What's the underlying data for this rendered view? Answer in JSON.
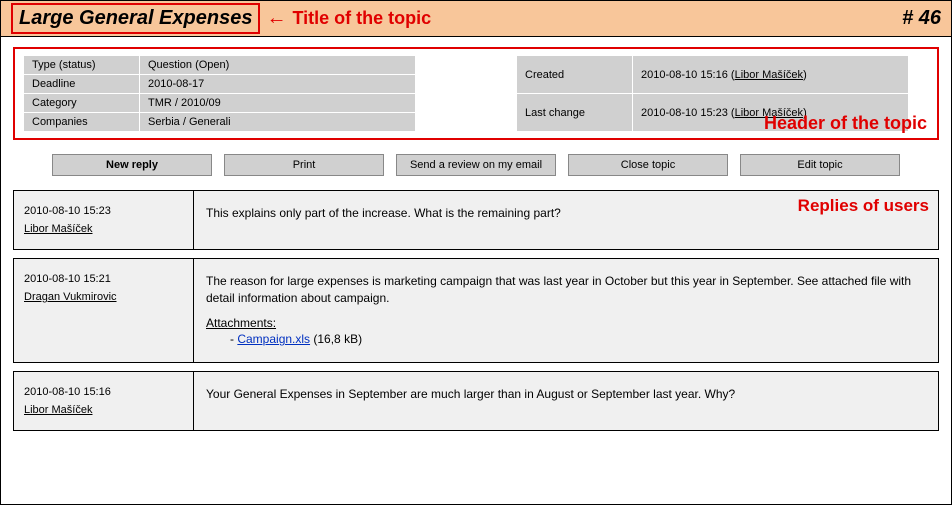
{
  "topic": {
    "title": "Large General Expenses",
    "number_label": "# 46"
  },
  "annotations": {
    "title": "Title of the topic",
    "arrow": "←",
    "header": "Header of the topic",
    "replies": "Replies of users"
  },
  "header": {
    "left": [
      {
        "k": "Type (status)",
        "v_plain": "Question (Open)"
      },
      {
        "k": "Deadline",
        "v_plain": "2010-08-17"
      },
      {
        "k": "Category",
        "v_plain": "TMR / 2010/09"
      },
      {
        "k": "Companies",
        "v_plain": "Serbia / Generali"
      }
    ],
    "right": [
      {
        "k": "Created",
        "v_prefix": "2010-08-10 15:16 (",
        "v_link": "Libor Mašíček",
        "v_suffix": ")"
      },
      {
        "k": "Last change",
        "v_prefix": "2010-08-10 15:23 (",
        "v_link": "Libor Mašíček",
        "v_suffix": ")"
      }
    ]
  },
  "buttons": {
    "new_reply": "New reply",
    "print": "Print",
    "review": "Send a review on my email",
    "close": "Close topic",
    "edit": "Edit topic"
  },
  "replies": [
    {
      "ts": "2010-08-10 15:23",
      "author": "Libor Mašíček",
      "body": "This explains only part of the increase. What is the remaining part?",
      "attachments_label": null,
      "attachments": []
    },
    {
      "ts": "2010-08-10 15:21",
      "author": "Dragan Vukmirovic",
      "body": "The reason for large expenses is marketing campaign that was last year in October but this year in September. See attached file with detail information about campaign.",
      "attachments_label": "Attachments:",
      "attachments": [
        {
          "name": "Campaign.xls",
          "size": " (16,8 kB)"
        }
      ]
    },
    {
      "ts": "2010-08-10 15:16",
      "author": "Libor Mašíček",
      "body": "Your General Expenses in September are much larger than in August or September last year. Why?",
      "attachments_label": null,
      "attachments": []
    }
  ]
}
